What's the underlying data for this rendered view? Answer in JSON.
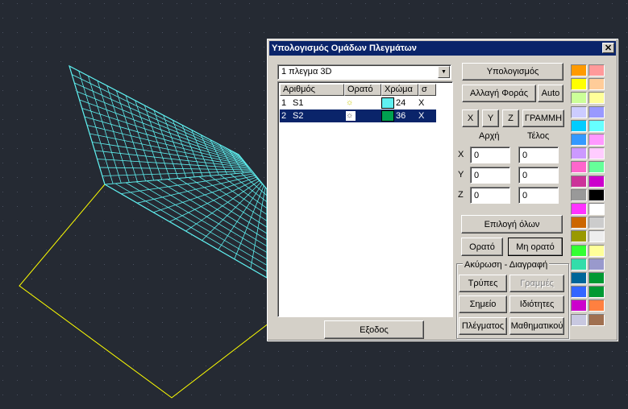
{
  "dialog": {
    "title": "Υπολογισμός Ομάδων Πλεγμάτων",
    "close_label": "✕",
    "mesh_select": {
      "value": "1 πλεγμα 3D"
    },
    "list": {
      "headers": [
        "Αριθμός",
        "Ορατό",
        "Χρώμα",
        "σ"
      ],
      "rows": [
        {
          "num": "1",
          "name": "S1",
          "color_value": "24",
          "x": "X",
          "swatch": "#5ff0f0",
          "selected": false,
          "visible_icon": "sun-icon"
        },
        {
          "num": "2",
          "name": "S2",
          "color_value": "36",
          "x": "X",
          "swatch": "#00a050",
          "selected": true,
          "visible_icon": "sun-icon"
        }
      ]
    },
    "buttons": {
      "compute": "Υπολογισμός",
      "change_direction": "Αλλαγή Φοράς",
      "auto": "Auto",
      "axis_x": "X",
      "axis_y": "Y",
      "axis_z": "Z",
      "line": "ΓΡΑΜΜΗ",
      "select_all": "Επιλογή όλων",
      "visible": "Ορατό",
      "not_visible": "Μη ορατό",
      "holes": "Τρύπες",
      "lines": "Γραμμές",
      "point": "Σημείο",
      "properties": "Ιδιότητες",
      "mesh": "Πλέγματος",
      "mathematical": "Μαθηματικού",
      "exit": "Εξοδος"
    },
    "range": {
      "start_label": "Αρχή",
      "end_label": "Τέλος",
      "rows": [
        {
          "axis": "X",
          "start": "0",
          "end": "0"
        },
        {
          "axis": "Y",
          "start": "0",
          "end": "0"
        },
        {
          "axis": "Z",
          "start": "0",
          "end": "0"
        }
      ]
    },
    "cancel_delete_group": "Ακύρωση - Διαγραφή",
    "palette": [
      "#ff9a00",
      "#ff9a9a",
      "#ffff00",
      "#ffcc99",
      "#ccff99",
      "#ffff99",
      "#ccccff",
      "#9999ff",
      "#00ccff",
      "#66ffff",
      "#3399ff",
      "#ff99ff",
      "#cc99ff",
      "#ffccff",
      "#ff66cc",
      "#66ff99",
      "#cc3399",
      "#cc00cc",
      "#999999",
      "#000000",
      "#ff33ff",
      "#ffffff",
      "#cc6600",
      "#cccccc",
      "#999900",
      "#eeeeee",
      "#33ff33",
      "#ffff99",
      "#33ddaa",
      "#9999cc",
      "#006699",
      "#009933",
      "#3366ff",
      "#009933",
      "#cc00cc",
      "#ff8040",
      "#c8c8e0",
      "#a07050"
    ]
  },
  "viewport": {
    "background": "#252a33",
    "mesh_color": "#5ff0f0",
    "outline_color": "#ffff00"
  }
}
